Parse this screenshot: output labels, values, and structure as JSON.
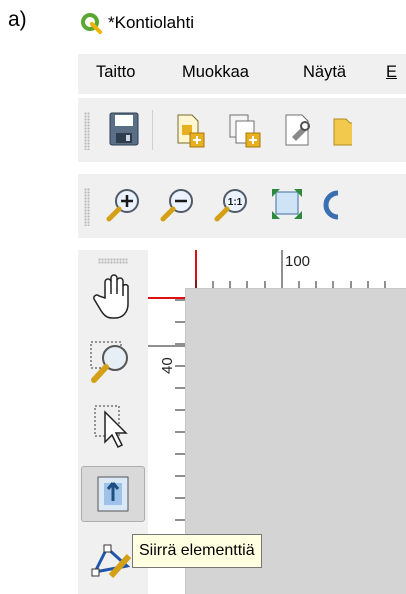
{
  "figure_label": "a)",
  "window": {
    "title": "*Kontiolahti",
    "app_icon": "qgis-logo-icon"
  },
  "menubar": {
    "items": [
      "Taitto",
      "Muokkaa",
      "Näytä",
      "E"
    ]
  },
  "toolbar1": {
    "buttons": [
      {
        "icon": "save-icon"
      },
      {
        "icon": "new-layout-icon"
      },
      {
        "icon": "duplicate-layout-icon"
      },
      {
        "icon": "layout-manager-icon"
      },
      {
        "icon": "open-folder-icon"
      }
    ]
  },
  "toolbar2": {
    "buttons": [
      {
        "icon": "zoom-in-icon"
      },
      {
        "icon": "zoom-out-icon"
      },
      {
        "icon": "zoom-actual-size-icon",
        "label": "1:1"
      },
      {
        "icon": "zoom-full-icon"
      },
      {
        "icon": "refresh-icon"
      }
    ]
  },
  "left_toolbar": {
    "tools": [
      {
        "icon": "pan-hand-icon",
        "active": false
      },
      {
        "icon": "zoom-tool-icon",
        "active": false
      },
      {
        "icon": "select-move-icon",
        "active": false
      },
      {
        "icon": "move-item-content-icon",
        "active": true
      },
      {
        "icon": "edit-nodes-icon",
        "active": false
      }
    ]
  },
  "rulers": {
    "horizontal_label": "100",
    "vertical_label": "40"
  },
  "tooltip": {
    "text": "Siirrä elementtiä"
  },
  "colors": {
    "toolbar_bg": "#f0f0f0",
    "canvas_bg": "#d4d4d4",
    "ruler_marker": "#e01010",
    "tooltip_bg": "#ffffe1"
  }
}
